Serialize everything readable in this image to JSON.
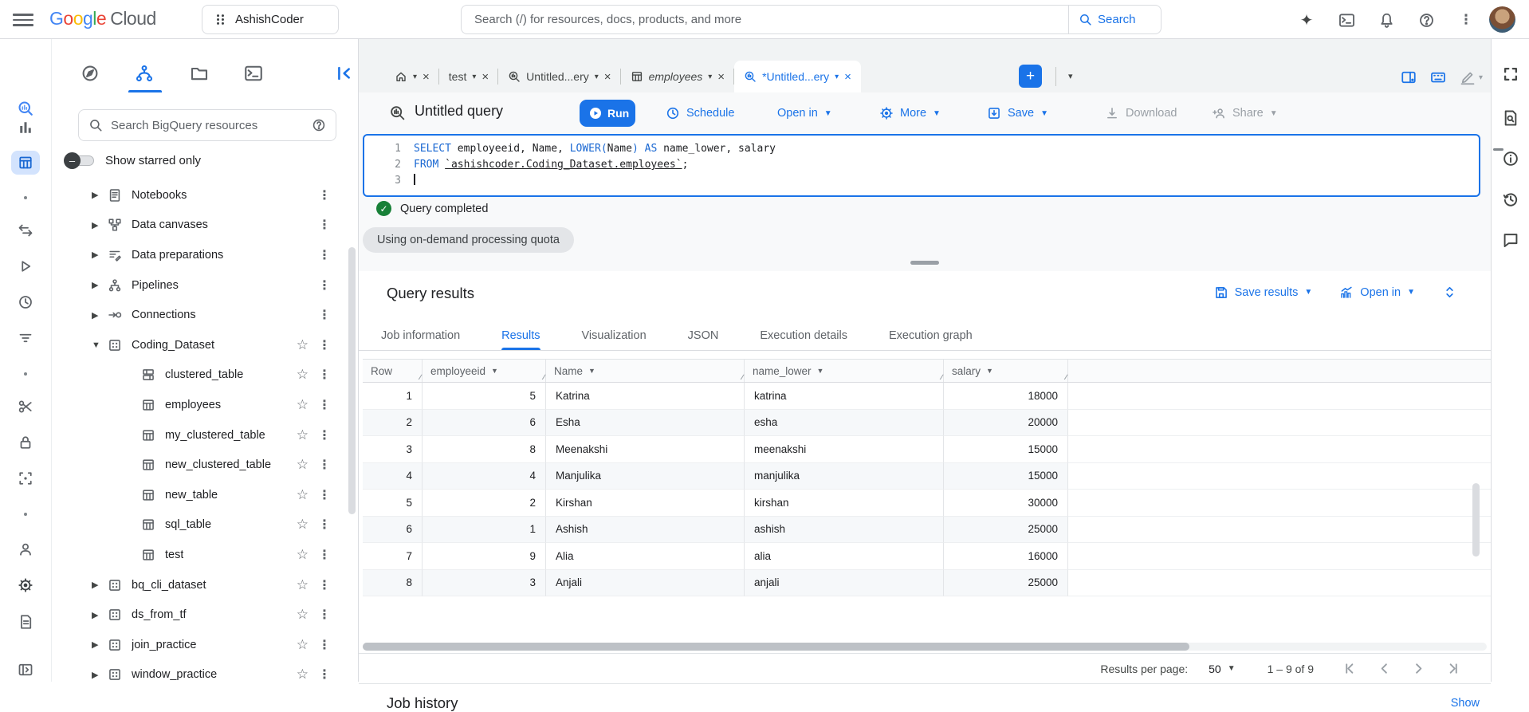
{
  "topbar": {
    "logo_google": "Google",
    "logo_cloud": "Cloud",
    "project_name": "AshishCoder",
    "search_placeholder": "Search (/) for resources, docs, products, and more",
    "search_button_label": "Search",
    "right_icons": [
      "gemini-icon",
      "cloud-shell-icon",
      "notifications-icon",
      "help-icon",
      "more-vert-icon"
    ]
  },
  "left_rail": {
    "icons": [
      "bigquery-logo",
      "analytics-icon",
      "studio-icon",
      "dot",
      "swap-icon",
      "run-icon",
      "clock-icon",
      "filter-icon",
      "dot",
      "scissors-icon",
      "lock-icon",
      "frame-icon",
      "dot",
      "person-icon",
      "settings-icon",
      "doc-icon",
      "panel-open-icon"
    ],
    "active_icon": "studio-icon"
  },
  "explorer": {
    "header_icons": [
      "compass-icon",
      "analysis-icon",
      "folder-icon",
      "terminal-icon"
    ],
    "active_header_icon": "analysis-icon",
    "collapse_icon": "collapse-panel-icon",
    "search_placeholder": "Search BigQuery resources",
    "starred_label": "Show starred only",
    "tree": [
      {
        "label": "Notebooks",
        "icon": "notebook",
        "arrow": "collapsed",
        "star": false,
        "child": false
      },
      {
        "label": "Data canvases",
        "icon": "canvas",
        "arrow": "collapsed",
        "star": false,
        "child": false
      },
      {
        "label": "Data preparations",
        "icon": "preparation",
        "arrow": "collapsed",
        "star": false,
        "child": false
      },
      {
        "label": "Pipelines",
        "icon": "pipeline",
        "arrow": "collapsed",
        "star": false,
        "child": false
      },
      {
        "label": "Connections",
        "icon": "connection",
        "arrow": "collapsed",
        "star": false,
        "child": false
      },
      {
        "label": "Coding_Dataset",
        "icon": "dataset",
        "arrow": "expanded",
        "star": true,
        "child": false
      },
      {
        "label": "clustered_table",
        "icon": "clustered-table",
        "arrow": "none",
        "star": true,
        "child": true
      },
      {
        "label": "employees",
        "icon": "table",
        "arrow": "none",
        "star": true,
        "child": true
      },
      {
        "label": "my_clustered_table",
        "icon": "table",
        "arrow": "none",
        "star": true,
        "child": true
      },
      {
        "label": "new_clustered_table",
        "icon": "table",
        "arrow": "none",
        "star": true,
        "child": true
      },
      {
        "label": "new_table",
        "icon": "table",
        "arrow": "none",
        "star": true,
        "child": true
      },
      {
        "label": "sql_table",
        "icon": "table",
        "arrow": "none",
        "star": true,
        "child": true
      },
      {
        "label": "test",
        "icon": "table",
        "arrow": "none",
        "star": true,
        "child": true
      },
      {
        "label": "bq_cli_dataset",
        "icon": "dataset",
        "arrow": "collapsed",
        "star": true,
        "child": false
      },
      {
        "label": "ds_from_tf",
        "icon": "dataset",
        "arrow": "collapsed",
        "star": true,
        "child": false
      },
      {
        "label": "join_practice",
        "icon": "dataset",
        "arrow": "collapsed",
        "star": true,
        "child": false
      },
      {
        "label": "window_practice",
        "icon": "dataset",
        "arrow": "collapsed",
        "star": true,
        "child": false
      }
    ]
  },
  "workspace_tabs": {
    "tabs": [
      {
        "label": "",
        "icon": "home",
        "active": false,
        "italic": false
      },
      {
        "label": "test",
        "icon": "",
        "active": false,
        "italic": false
      },
      {
        "label": "Untitled...ery",
        "icon": "query",
        "active": false,
        "italic": false
      },
      {
        "label": "employees",
        "icon": "table",
        "active": false,
        "italic": true
      },
      {
        "label": "*Untitled...ery",
        "icon": "query",
        "active": true,
        "italic": false
      }
    ],
    "add_tab_label": "+",
    "right_icons": [
      "split-panel-icon",
      "keyboard-icon",
      "edit-icon",
      "fullscreen-icon"
    ]
  },
  "editor": {
    "title": "Untitled query",
    "run_label": "Run",
    "schedule_label": "Schedule",
    "open_in_label": "Open in",
    "more_label": "More",
    "save_label": "Save",
    "download_label": "Download",
    "share_label": "Share",
    "code_lines": [
      {
        "num": "1",
        "segments": [
          [
            "kw",
            "SELECT"
          ],
          [
            "pl",
            " employeeid, Name, "
          ],
          [
            "kw",
            "LOWER("
          ],
          [
            "pl",
            "Name"
          ],
          [
            "kw",
            ")"
          ],
          [
            "pl",
            " "
          ],
          [
            "kw",
            "AS"
          ],
          [
            "pl",
            " name_lower, salary"
          ]
        ]
      },
      {
        "num": "2",
        "segments": [
          [
            "kw",
            "FROM"
          ],
          [
            "pl",
            " "
          ],
          [
            "ref",
            "`ashishcoder.Coding_Dataset.employees`"
          ],
          [
            "pl",
            ";"
          ]
        ]
      },
      {
        "num": "3",
        "segments": [
          [
            "cursor",
            ""
          ]
        ]
      }
    ]
  },
  "status": {
    "completed_label": "Query completed",
    "quota_chip": "Using on-demand processing quota"
  },
  "results": {
    "title": "Query results",
    "save_results_label": "Save results",
    "open_in_label": "Open in",
    "tabs": [
      "Job information",
      "Results",
      "Visualization",
      "JSON",
      "Execution details",
      "Execution graph"
    ],
    "active_tab": "Results",
    "columns": [
      "Row",
      "employeeid",
      "Name",
      "name_lower",
      "salary"
    ],
    "rows": [
      [
        "1",
        "5",
        "Katrina",
        "katrina",
        "18000"
      ],
      [
        "2",
        "6",
        "Esha",
        "esha",
        "20000"
      ],
      [
        "3",
        "8",
        "Meenakshi",
        "meenakshi",
        "15000"
      ],
      [
        "4",
        "4",
        "Manjulika",
        "manjulika",
        "15000"
      ],
      [
        "5",
        "2",
        "Kirshan",
        "kirshan",
        "30000"
      ],
      [
        "6",
        "1",
        "Ashish",
        "ashish",
        "25000"
      ],
      [
        "7",
        "9",
        "Alia",
        "alia",
        "16000"
      ],
      [
        "8",
        "3",
        "Anjali",
        "anjali",
        "25000"
      ]
    ],
    "pagination": {
      "per_page_label": "Results per page:",
      "per_page_value": "50",
      "range_label": "1 – 9 of 9"
    }
  },
  "job_history": {
    "title": "Job history",
    "show_label": "Show"
  },
  "colors": {
    "accent": "#1a73e8",
    "keyword": "#1967d2",
    "success": "#188038",
    "text": "#202124",
    "muted": "#5f6368"
  }
}
